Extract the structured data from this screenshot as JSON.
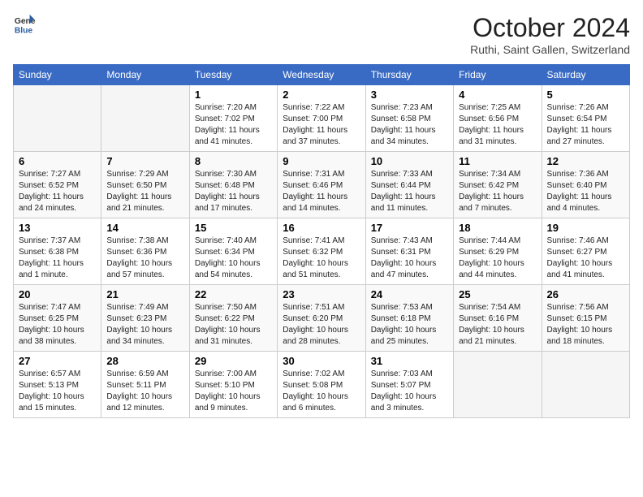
{
  "header": {
    "logo_general": "General",
    "logo_blue": "Blue",
    "month_title": "October 2024",
    "location": "Ruthi, Saint Gallen, Switzerland"
  },
  "columns": [
    "Sunday",
    "Monday",
    "Tuesday",
    "Wednesday",
    "Thursday",
    "Friday",
    "Saturday"
  ],
  "weeks": [
    [
      {
        "day": "",
        "info": ""
      },
      {
        "day": "",
        "info": ""
      },
      {
        "day": "1",
        "info": "Sunrise: 7:20 AM\nSunset: 7:02 PM\nDaylight: 11 hours and 41 minutes."
      },
      {
        "day": "2",
        "info": "Sunrise: 7:22 AM\nSunset: 7:00 PM\nDaylight: 11 hours and 37 minutes."
      },
      {
        "day": "3",
        "info": "Sunrise: 7:23 AM\nSunset: 6:58 PM\nDaylight: 11 hours and 34 minutes."
      },
      {
        "day": "4",
        "info": "Sunrise: 7:25 AM\nSunset: 6:56 PM\nDaylight: 11 hours and 31 minutes."
      },
      {
        "day": "5",
        "info": "Sunrise: 7:26 AM\nSunset: 6:54 PM\nDaylight: 11 hours and 27 minutes."
      }
    ],
    [
      {
        "day": "6",
        "info": "Sunrise: 7:27 AM\nSunset: 6:52 PM\nDaylight: 11 hours and 24 minutes."
      },
      {
        "day": "7",
        "info": "Sunrise: 7:29 AM\nSunset: 6:50 PM\nDaylight: 11 hours and 21 minutes."
      },
      {
        "day": "8",
        "info": "Sunrise: 7:30 AM\nSunset: 6:48 PM\nDaylight: 11 hours and 17 minutes."
      },
      {
        "day": "9",
        "info": "Sunrise: 7:31 AM\nSunset: 6:46 PM\nDaylight: 11 hours and 14 minutes."
      },
      {
        "day": "10",
        "info": "Sunrise: 7:33 AM\nSunset: 6:44 PM\nDaylight: 11 hours and 11 minutes."
      },
      {
        "day": "11",
        "info": "Sunrise: 7:34 AM\nSunset: 6:42 PM\nDaylight: 11 hours and 7 minutes."
      },
      {
        "day": "12",
        "info": "Sunrise: 7:36 AM\nSunset: 6:40 PM\nDaylight: 11 hours and 4 minutes."
      }
    ],
    [
      {
        "day": "13",
        "info": "Sunrise: 7:37 AM\nSunset: 6:38 PM\nDaylight: 11 hours and 1 minute."
      },
      {
        "day": "14",
        "info": "Sunrise: 7:38 AM\nSunset: 6:36 PM\nDaylight: 10 hours and 57 minutes."
      },
      {
        "day": "15",
        "info": "Sunrise: 7:40 AM\nSunset: 6:34 PM\nDaylight: 10 hours and 54 minutes."
      },
      {
        "day": "16",
        "info": "Sunrise: 7:41 AM\nSunset: 6:32 PM\nDaylight: 10 hours and 51 minutes."
      },
      {
        "day": "17",
        "info": "Sunrise: 7:43 AM\nSunset: 6:31 PM\nDaylight: 10 hours and 47 minutes."
      },
      {
        "day": "18",
        "info": "Sunrise: 7:44 AM\nSunset: 6:29 PM\nDaylight: 10 hours and 44 minutes."
      },
      {
        "day": "19",
        "info": "Sunrise: 7:46 AM\nSunset: 6:27 PM\nDaylight: 10 hours and 41 minutes."
      }
    ],
    [
      {
        "day": "20",
        "info": "Sunrise: 7:47 AM\nSunset: 6:25 PM\nDaylight: 10 hours and 38 minutes."
      },
      {
        "day": "21",
        "info": "Sunrise: 7:49 AM\nSunset: 6:23 PM\nDaylight: 10 hours and 34 minutes."
      },
      {
        "day": "22",
        "info": "Sunrise: 7:50 AM\nSunset: 6:22 PM\nDaylight: 10 hours and 31 minutes."
      },
      {
        "day": "23",
        "info": "Sunrise: 7:51 AM\nSunset: 6:20 PM\nDaylight: 10 hours and 28 minutes."
      },
      {
        "day": "24",
        "info": "Sunrise: 7:53 AM\nSunset: 6:18 PM\nDaylight: 10 hours and 25 minutes."
      },
      {
        "day": "25",
        "info": "Sunrise: 7:54 AM\nSunset: 6:16 PM\nDaylight: 10 hours and 21 minutes."
      },
      {
        "day": "26",
        "info": "Sunrise: 7:56 AM\nSunset: 6:15 PM\nDaylight: 10 hours and 18 minutes."
      }
    ],
    [
      {
        "day": "27",
        "info": "Sunrise: 6:57 AM\nSunset: 5:13 PM\nDaylight: 10 hours and 15 minutes."
      },
      {
        "day": "28",
        "info": "Sunrise: 6:59 AM\nSunset: 5:11 PM\nDaylight: 10 hours and 12 minutes."
      },
      {
        "day": "29",
        "info": "Sunrise: 7:00 AM\nSunset: 5:10 PM\nDaylight: 10 hours and 9 minutes."
      },
      {
        "day": "30",
        "info": "Sunrise: 7:02 AM\nSunset: 5:08 PM\nDaylight: 10 hours and 6 minutes."
      },
      {
        "day": "31",
        "info": "Sunrise: 7:03 AM\nSunset: 5:07 PM\nDaylight: 10 hours and 3 minutes."
      },
      {
        "day": "",
        "info": ""
      },
      {
        "day": "",
        "info": ""
      }
    ]
  ]
}
